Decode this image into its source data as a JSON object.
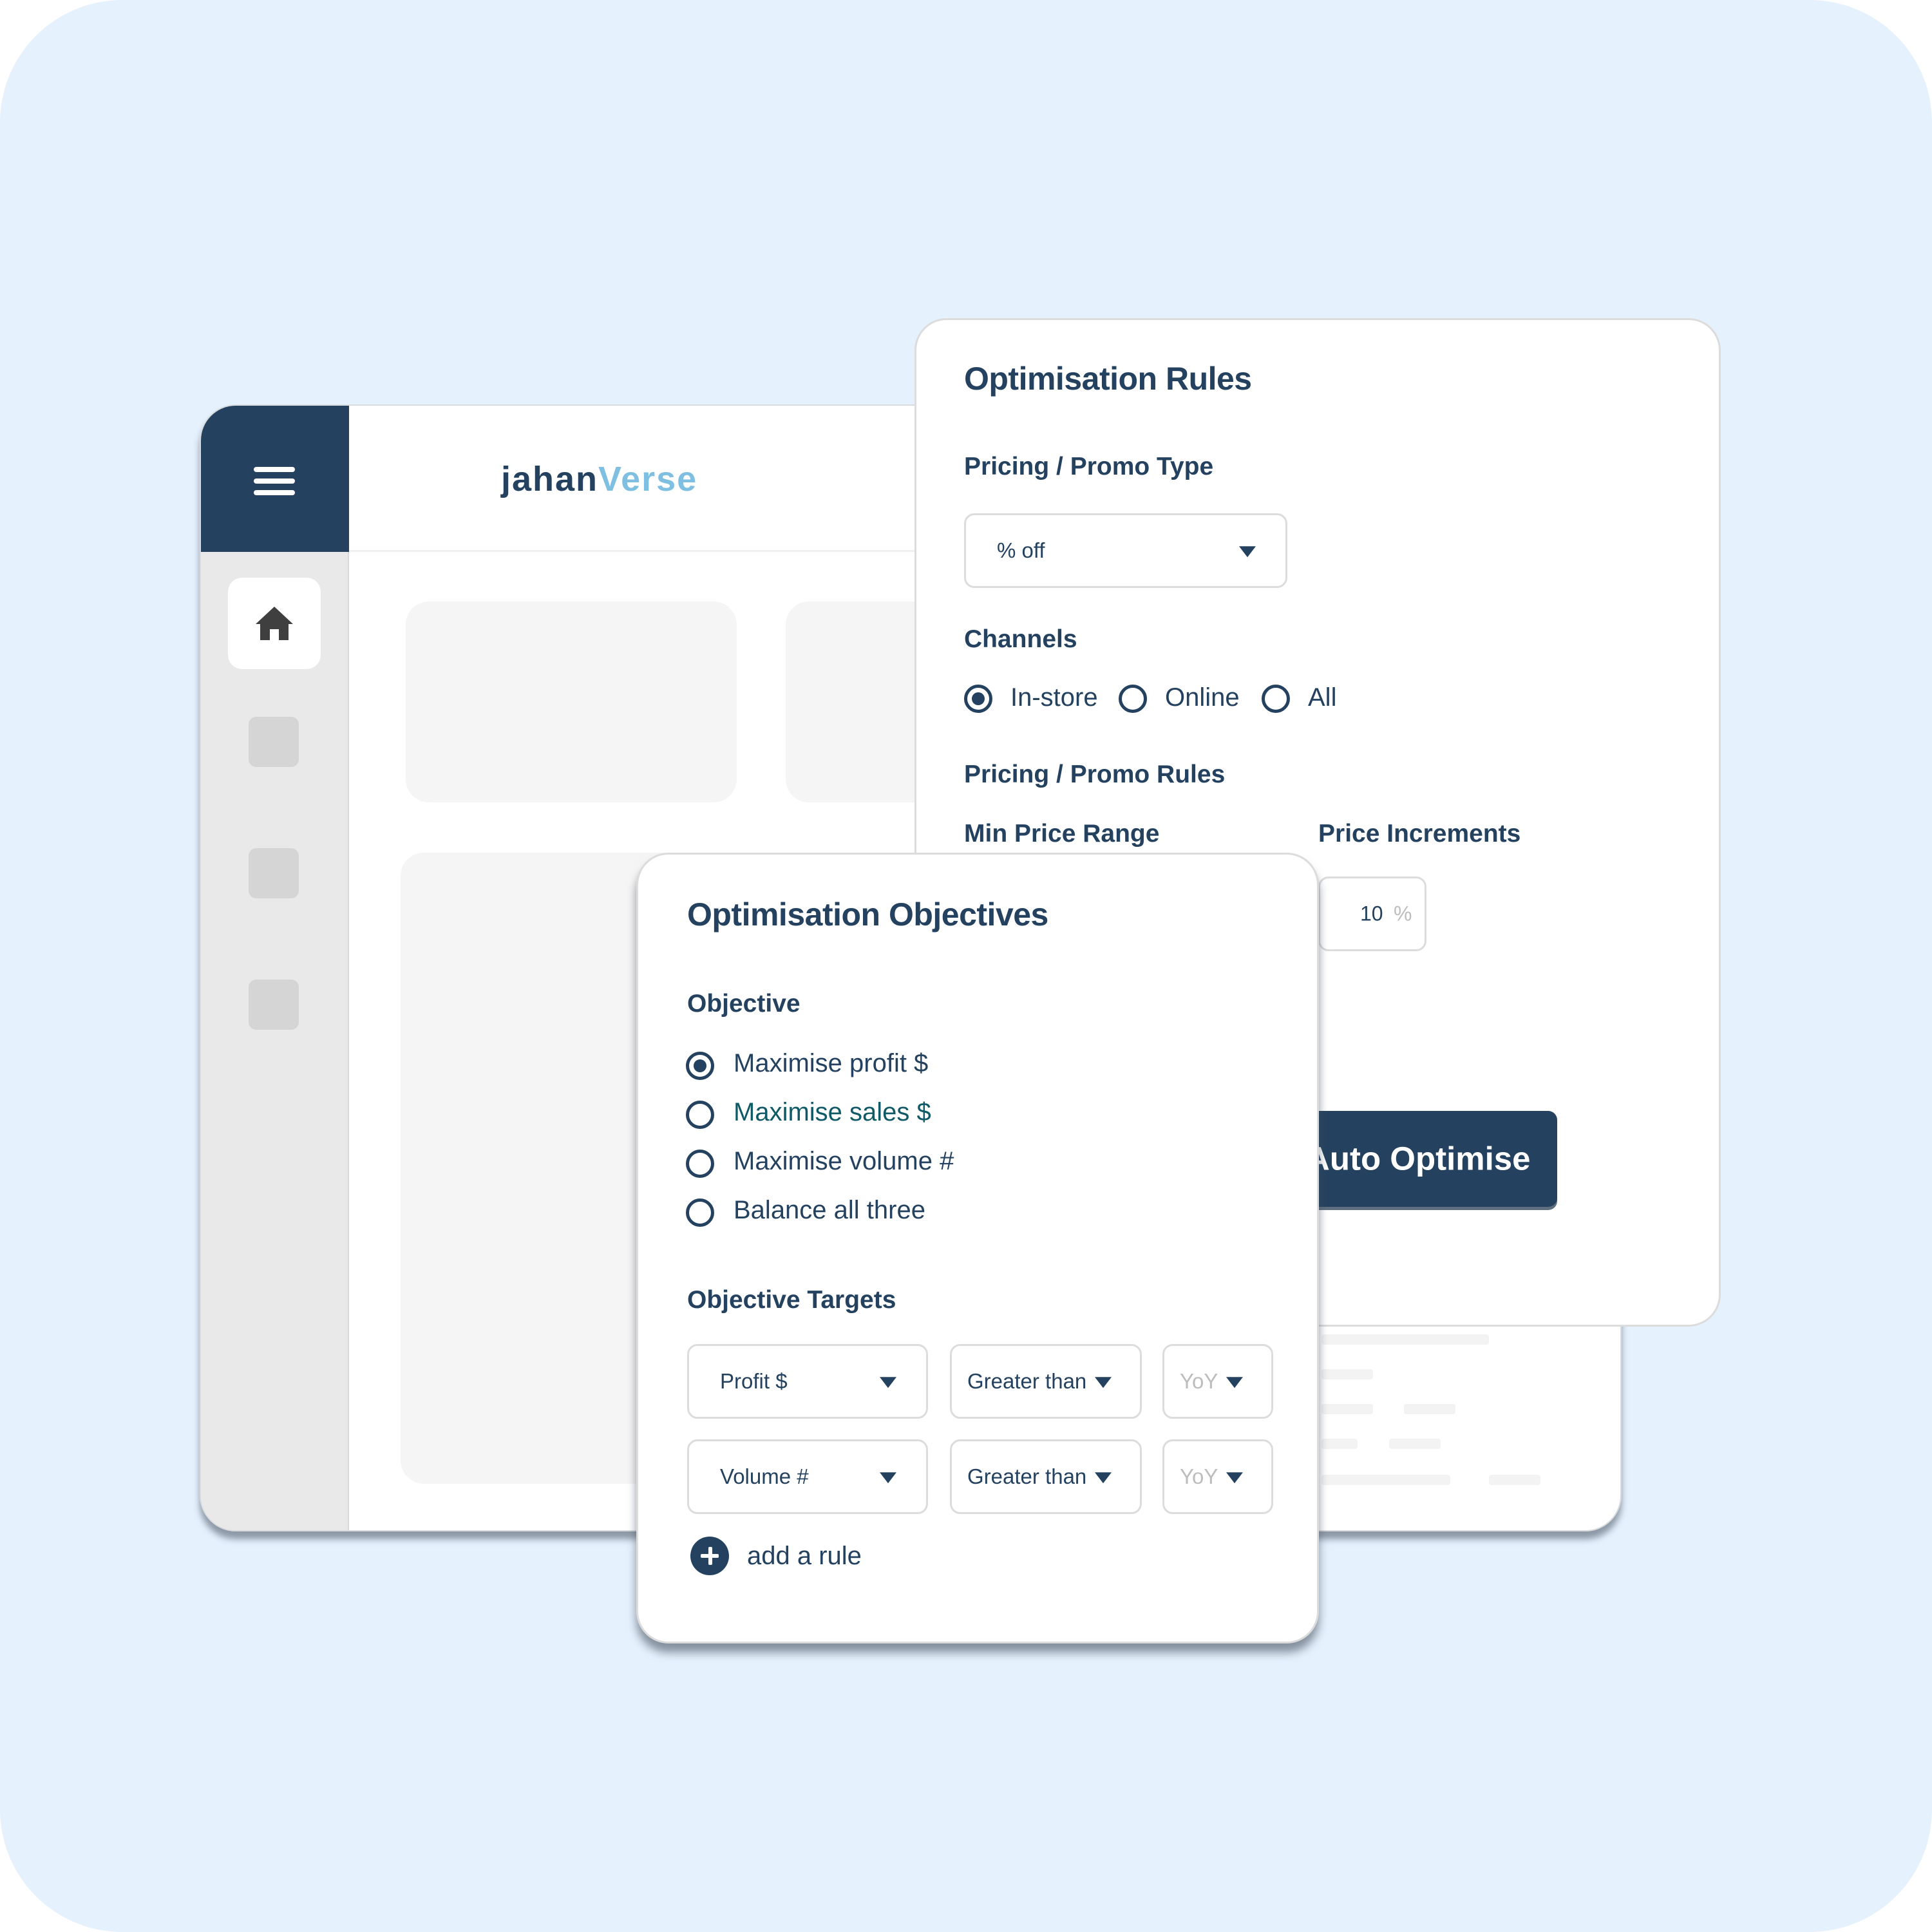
{
  "app": {
    "brand": {
      "part1": "jahan",
      "part2": "Verse"
    },
    "menu_icon": "hamburger-menu-icon",
    "sidebar": {
      "items": [
        {
          "icon": "home-icon",
          "active": true
        },
        {
          "icon": "placeholder",
          "active": false
        },
        {
          "icon": "placeholder",
          "active": false
        },
        {
          "icon": "placeholder",
          "active": false
        }
      ]
    }
  },
  "rules": {
    "title": "Optimisation Rules",
    "promo_type": {
      "label": "Pricing / Promo Type",
      "value": "% off"
    },
    "channels": {
      "label": "Channels",
      "options": [
        {
          "label": "In-store",
          "selected": true
        },
        {
          "label": "Online",
          "selected": false
        },
        {
          "label": "All",
          "selected": false
        }
      ]
    },
    "promo_rules": {
      "label": "Pricing / Promo Rules",
      "min_price_range_label": "Min Price Range",
      "price_increments_label": "Price Increments",
      "price_increments_value": "10",
      "price_increments_unit": "%"
    }
  },
  "auto_optimise": {
    "label": "Auto Optimise",
    "icon": "sparkle-icon"
  },
  "objectives": {
    "title": "Optimisation Objectives",
    "objective_label": "Objective",
    "options": [
      {
        "label": "Maximise profit $",
        "selected": true
      },
      {
        "label": "Maximise sales $",
        "selected": false
      },
      {
        "label": "Maximise volume #",
        "selected": false
      },
      {
        "label": "Balance all three",
        "selected": false
      }
    ],
    "targets_label": "Objective Targets",
    "targets": [
      {
        "metric": "Profit $",
        "comparator": "Greater than",
        "period": "YoY"
      },
      {
        "metric": "Volume #",
        "comparator": "Greater than",
        "period": "YoY"
      }
    ],
    "add_rule_label": "add a rule"
  },
  "colors": {
    "primary": "#24425F",
    "brand_accent": "#7FC0E2",
    "background": "#E5F1FD",
    "sales_option_text": "#0F5A66"
  }
}
